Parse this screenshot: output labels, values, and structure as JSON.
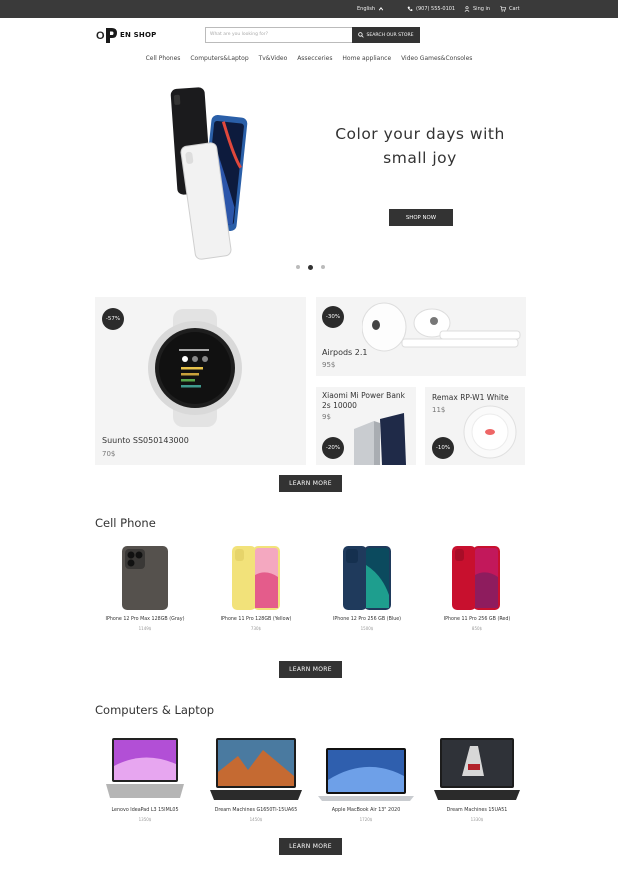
{
  "topbar": {
    "language": "English",
    "phone": "(907) 555-0101",
    "signin": "Sing in",
    "cart": "Cart"
  },
  "header": {
    "logo_mark": "O",
    "logo_text": "EN SHOP",
    "search_placeholder": "What are you looking for?",
    "search_button": "SEARCH OUR STORE"
  },
  "nav": {
    "items": [
      "Cell Phones",
      "Computers&Laptop",
      "Tv&Video",
      "Assecceries",
      "Home appliance",
      "Video Games&Consoles"
    ]
  },
  "hero": {
    "title_line1": "Color your days with",
    "title_line2": "small joy",
    "button": "SHOP NOW",
    "slides": 3,
    "active_slide": 2
  },
  "promo": {
    "watch": {
      "badge": "-57%",
      "name": "Suunto SS050143000",
      "price": "70$"
    },
    "airpods": {
      "badge": "-30%",
      "name": "Airpods 2.1",
      "price": "95$"
    },
    "powerbank": {
      "badge": "-20%",
      "name_line1": "Xiaomi Mi Power Bank",
      "name_line2": "2s 10000",
      "price": "9$"
    },
    "remax": {
      "badge": "-10%",
      "name": "Remax RP-W1 White",
      "price": "11$"
    },
    "learn_more": "LEARN MORE"
  },
  "cell_phone": {
    "title": "Cell Phone",
    "items": [
      {
        "name": "IPhone 12 Pro Max 128GB (Gray)",
        "price": "1149$"
      },
      {
        "name": "IPhone 11 Pro 128GB (Yellow)",
        "price": "730$"
      },
      {
        "name": "IPhone 12 Pro 256 GB (Blue)",
        "price": "1500$"
      },
      {
        "name": "IPhone 11 Pro 256 GB (Red)",
        "price": "850$"
      }
    ],
    "learn_more": "LEARN MORE"
  },
  "computers": {
    "title": "Computers & Laptop",
    "items": [
      {
        "name": "Lenovo IdeaPad L3 15IML05",
        "price": "1350$"
      },
      {
        "name": "Dream Machines G1650Ti-15UA65",
        "price": "1450$"
      },
      {
        "name": "Apple MacBook Air 13\" 2020",
        "price": "1720$"
      },
      {
        "name": "Dream Machines 15UA51",
        "price": "1330$"
      }
    ],
    "learn_more": "LEARN MORE"
  },
  "colors": {
    "dark": "#333333",
    "card_bg": "#f4f4f4",
    "topbar": "#3a3a3a"
  }
}
